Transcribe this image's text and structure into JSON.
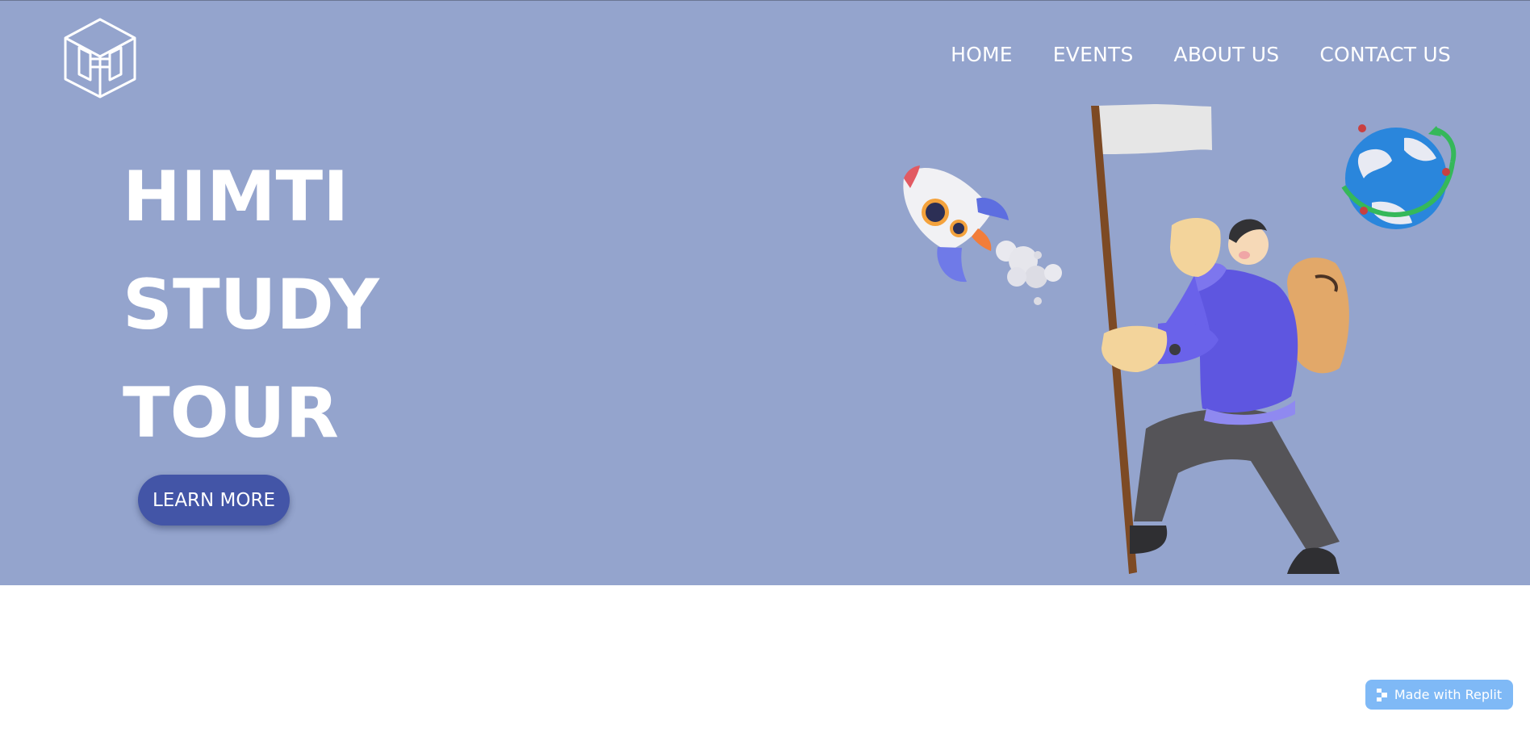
{
  "nav": {
    "items": [
      {
        "label": "HOME"
      },
      {
        "label": "EVENTS"
      },
      {
        "label": "ABOUT US"
      },
      {
        "label": "CONTACT US"
      }
    ]
  },
  "hero": {
    "title_lines": [
      "HIMTI",
      "STUDY",
      "TOUR"
    ],
    "cta_label": "LEARN MORE",
    "background_color": "#94a4cd",
    "cta_color": "#4355a7"
  },
  "badge": {
    "label": "Made with Replit",
    "icon": "replit-icon"
  }
}
